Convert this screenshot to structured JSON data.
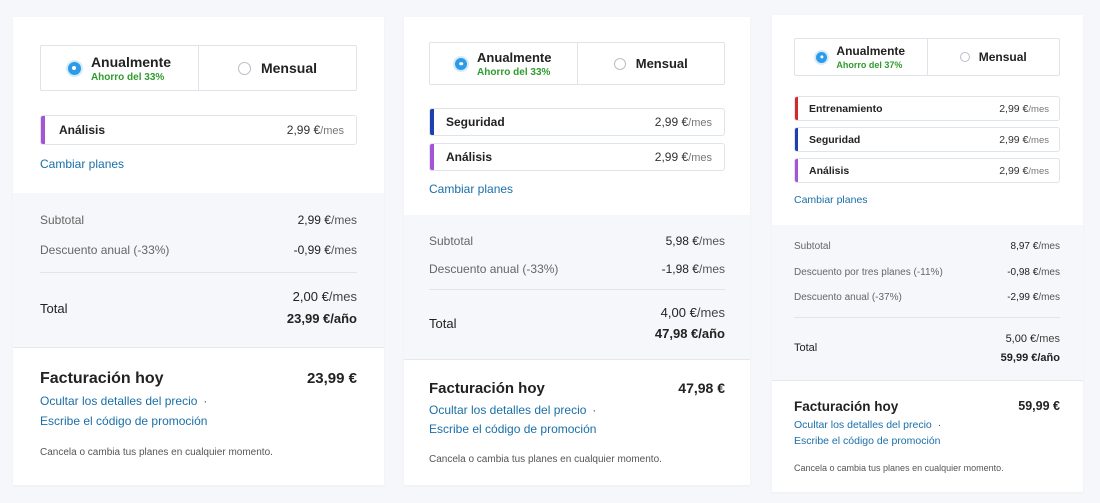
{
  "cards": [
    {
      "toggle": {
        "annual_label": "Anualmente",
        "annual_savings": "Ahorro del 33%",
        "monthly_label": "Mensual"
      },
      "plans": [
        {
          "name": "Análisis",
          "price": "2,99 €",
          "unit": "/mes",
          "color": "#a554d8"
        }
      ],
      "change_plans": "Cambiar planes",
      "summary": [
        {
          "label": "Subtotal",
          "amount": "2,99 €",
          "unit": "/mes"
        },
        {
          "label": "Descuento anual (-33%)",
          "amount": "-0,99 €",
          "unit": "/mes"
        }
      ],
      "total": {
        "label": "Total",
        "monthly": "2,00 €",
        "monthly_unit": "/mes",
        "yearly": "23,99 €",
        "yearly_unit": "/año"
      },
      "billing": {
        "label": "Facturación hoy",
        "amount": "23,99 €",
        "hide_details": "Ocultar los detalles del precio",
        "dot": "·",
        "promo": "Escribe el código de promoción",
        "footnote": "Cancela o cambia tus planes en cualquier momento."
      }
    },
    {
      "toggle": {
        "annual_label": "Anualmente",
        "annual_savings": "Ahorro del 33%",
        "monthly_label": "Mensual"
      },
      "plans": [
        {
          "name": "Seguridad",
          "price": "2,99 €",
          "unit": "/mes",
          "color": "#1f3fae"
        },
        {
          "name": "Análisis",
          "price": "2,99 €",
          "unit": "/mes",
          "color": "#a554d8"
        }
      ],
      "change_plans": "Cambiar planes",
      "summary": [
        {
          "label": "Subtotal",
          "amount": "5,98 €",
          "unit": "/mes"
        },
        {
          "label": "Descuento anual (-33%)",
          "amount": "-1,98 €",
          "unit": "/mes"
        }
      ],
      "total": {
        "label": "Total",
        "monthly": "4,00 €",
        "monthly_unit": "/mes",
        "yearly": "47,98 €",
        "yearly_unit": "/año"
      },
      "billing": {
        "label": "Facturación hoy",
        "amount": "47,98 €",
        "hide_details": "Ocultar los detalles del precio",
        "dot": "·",
        "promo": "Escribe el código de promoción",
        "footnote": "Cancela o cambia tus planes en cualquier momento."
      }
    },
    {
      "toggle": {
        "annual_label": "Anualmente",
        "annual_savings": "Ahorro del 37%",
        "monthly_label": "Mensual"
      },
      "plans": [
        {
          "name": "Entrenamiento",
          "price": "2,99 €",
          "unit": "/mes",
          "color": "#d42a2a"
        },
        {
          "name": "Seguridad",
          "price": "2,99 €",
          "unit": "/mes",
          "color": "#1f3fae"
        },
        {
          "name": "Análisis",
          "price": "2,99 €",
          "unit": "/mes",
          "color": "#a554d8"
        }
      ],
      "change_plans": "Cambiar planes",
      "summary": [
        {
          "label": "Subtotal",
          "amount": "8,97 €",
          "unit": "/mes"
        },
        {
          "label": "Descuento por tres planes (-11%)",
          "amount": "-0,98 €",
          "unit": "/mes"
        },
        {
          "label": "Descuento anual (-37%)",
          "amount": "-2,99 €",
          "unit": "/mes"
        }
      ],
      "total": {
        "label": "Total",
        "monthly": "5,00 €",
        "monthly_unit": "/mes",
        "yearly": "59,99 €",
        "yearly_unit": "/año"
      },
      "billing": {
        "label": "Facturación hoy",
        "amount": "59,99 €",
        "hide_details": "Ocultar los detalles del precio",
        "dot": "·",
        "promo": "Escribe el código de promoción",
        "footnote": "Cancela o cambia tus planes en cualquier momento."
      }
    }
  ]
}
